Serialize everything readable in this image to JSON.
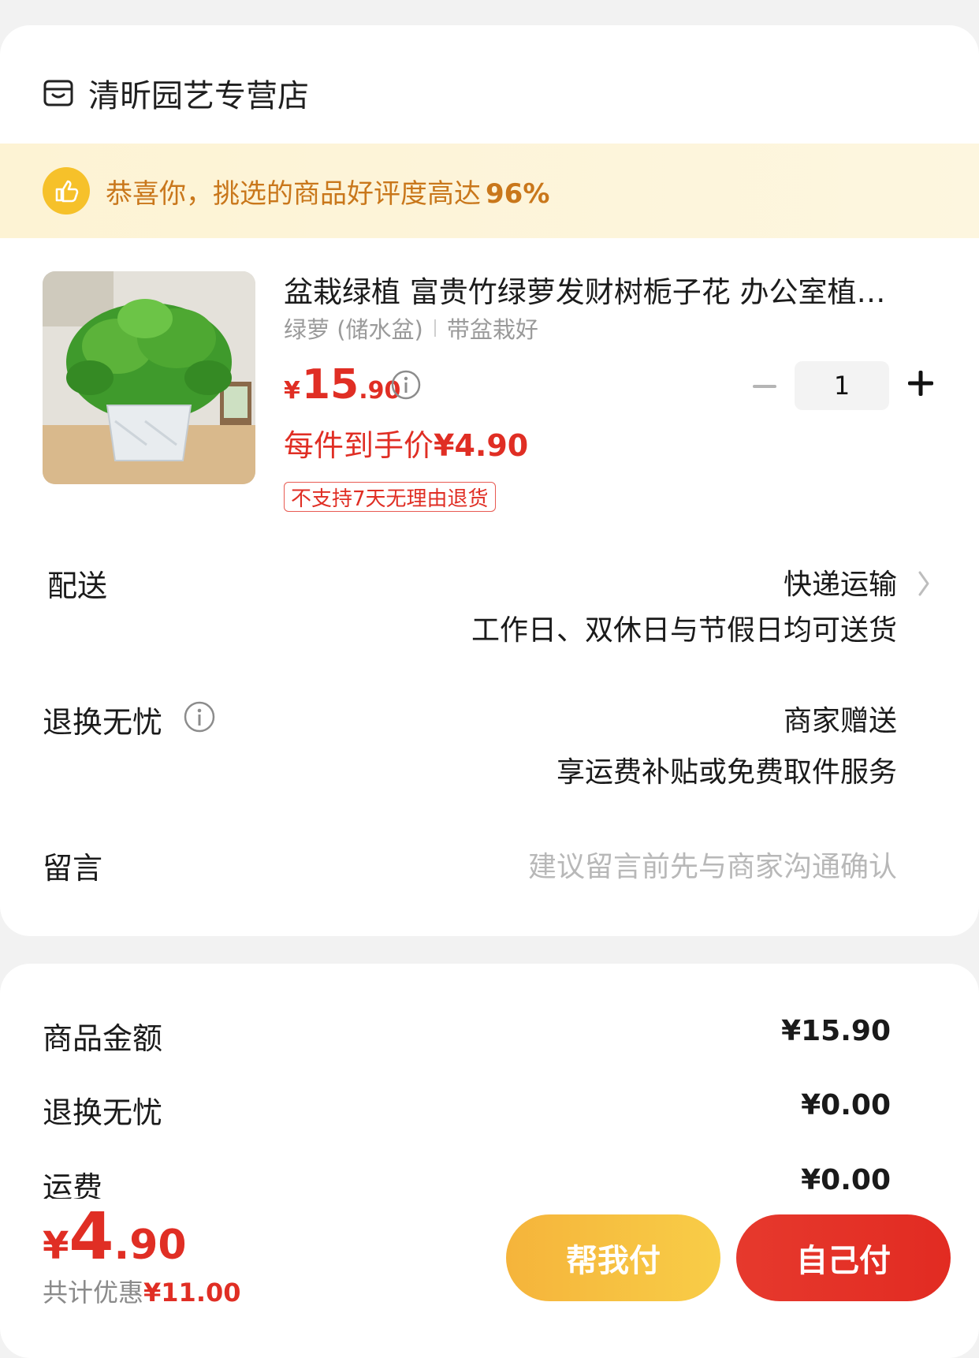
{
  "store": {
    "name": "清昕园艺专营店",
    "icon": "store-icon"
  },
  "praise": {
    "text": "恭喜你，挑选的商品好评度高达",
    "percent": "96%",
    "icon": "thumbs-up-icon"
  },
  "product": {
    "title": "盆栽绿植 富贵竹绿萝发财树栀子花 办公室植…",
    "spec_1": "绿萝 (储水盆)",
    "spec_2": "带盆栽好",
    "price_currency": "¥",
    "price_int": "15",
    "price_dec": ".90",
    "final_price_label": "每件到手价",
    "final_price": "¥4.90",
    "return_tag": "不支持7天无理由退货",
    "quantity": "1"
  },
  "delivery": {
    "label": "配送",
    "method": "快递运输",
    "note": "工作日、双休日与节假日均可送货"
  },
  "worry_free": {
    "label": "退换无忧",
    "value": "商家赠送",
    "note": "享运费补贴或免费取件服务"
  },
  "message": {
    "label": "留言",
    "placeholder": "建议留言前先与商家沟通确认"
  },
  "summary": {
    "goods_label": "商品金额",
    "goods_value": "¥15.90",
    "worry_label": "退换无忧",
    "worry_value": "¥0.00",
    "shipping_label": "运费",
    "shipping_value": "¥0.00"
  },
  "footer": {
    "total_currency": "¥",
    "total_int": "4",
    "total_dec": ".90",
    "discount_label": "共计优惠",
    "discount_value": "¥11.00",
    "help_pay_label": "帮我付",
    "self_pay_label": "自己付"
  },
  "colors": {
    "accent_red": "#e02e24",
    "praise_orange": "#c9771b",
    "help_button": "#f5b43b",
    "banner_bg": "#fdf3d4"
  }
}
